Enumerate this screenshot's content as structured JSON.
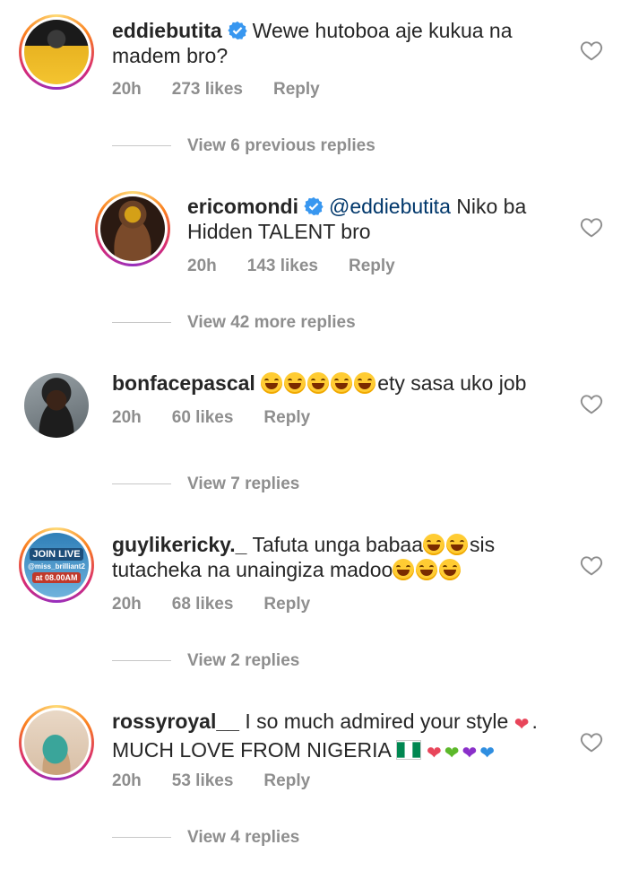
{
  "comments": [
    {
      "username": "eddiebutita",
      "text": "Wewe hutoboa aje kukua na madem bro?",
      "line1": "Wewe hutoboa aje kukua na",
      "line2": "madem bro?",
      "time": "20h",
      "likes": "273 likes",
      "reply": "Reply",
      "view_replies": "View 6 previous replies"
    },
    {
      "username": "ericomondi",
      "mention": "@eddiebutita",
      "line1": "Niko ba",
      "line2": "Hidden TALENT bro",
      "time": "20h",
      "likes": "143 likes",
      "reply": "Reply",
      "view_replies": "View 42 more replies"
    },
    {
      "username": "bonfacepascal",
      "line1": "ety sasa uko job",
      "time": "20h",
      "likes": "60 likes",
      "reply": "Reply",
      "view_replies": "View 7 replies"
    },
    {
      "username": "guylikericky._",
      "line1": "Tafuta unga babaa",
      "line1b": "sis",
      "line2": "tutacheka na unaingiza madoo",
      "time": "20h",
      "likes": "68 likes",
      "reply": "Reply",
      "view_replies": "View 2 replies",
      "avatar_text": [
        "JOIN LIVE",
        "@miss_brilliant2",
        "at 08.00AM"
      ]
    },
    {
      "username": "rossyroyal__",
      "line1": "I so much admired your style",
      "line2": "MUCH LOVE FROM NIGERIA",
      "time": "20h",
      "likes": "53 likes",
      "reply": "Reply",
      "view_replies": "View 4 replies"
    }
  ],
  "colors": {
    "text": "#262626",
    "meta": "#8e8e8e",
    "mention": "#00376b",
    "verified": "#3897f0"
  }
}
